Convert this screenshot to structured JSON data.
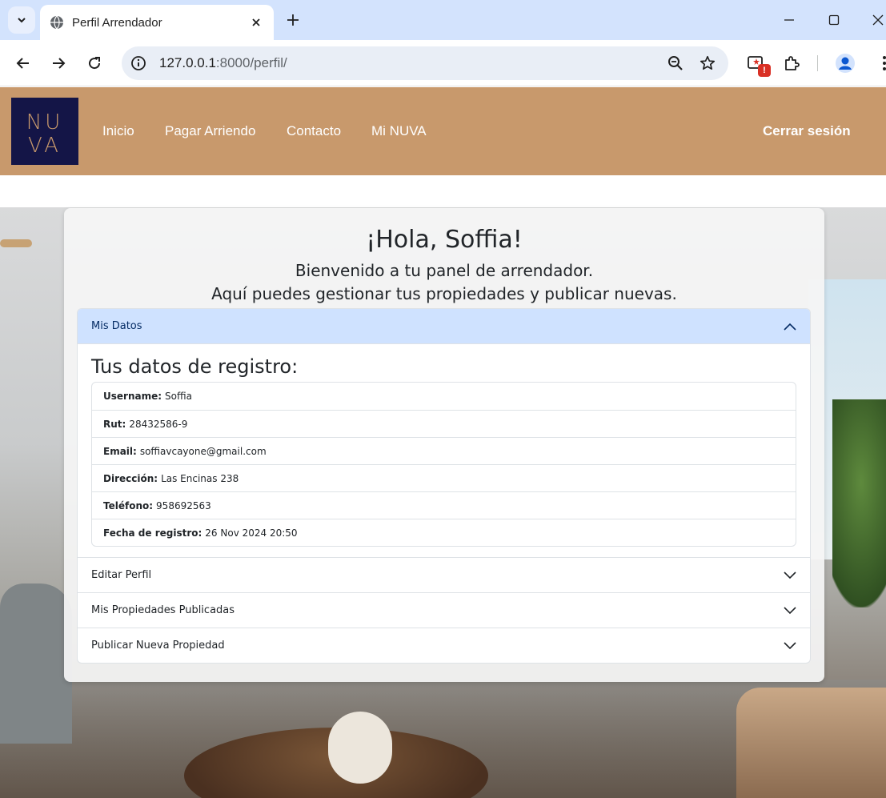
{
  "browser": {
    "tab_title": "Perfil Arrendador",
    "url_host": "127.0.0.1",
    "url_path": ":8000/perfil/",
    "extension_badge": "!"
  },
  "header": {
    "logo_top": "NU",
    "logo_bottom": "VA",
    "nav": [
      "Inicio",
      "Pagar Arriendo",
      "Contacto",
      "Mi NUVA"
    ],
    "logout": "Cerrar sesión"
  },
  "panel": {
    "greeting": "¡Hola, Soffia!",
    "welcome_line1": "Bienvenido a tu panel de arrendador.",
    "welcome_line2": "Aquí puedes gestionar tus propiedades y publicar nuevas."
  },
  "accordion": {
    "mis_datos": "Mis Datos",
    "section_title": "Tus datos de registro:",
    "fields": [
      {
        "label": "Username:",
        "value": "Soffia"
      },
      {
        "label": "Rut:",
        "value": "28432586-9"
      },
      {
        "label": "Email:",
        "value": "soffiavcayone@gmail.com"
      },
      {
        "label": "Dirección:",
        "value": "Las Encinas 238"
      },
      {
        "label": "Teléfono:",
        "value": "958692563"
      },
      {
        "label": "Fecha de registro:",
        "value": "26 Nov 2024 20:50"
      }
    ],
    "editar_perfil": "Editar Perfil",
    "mis_propiedades": "Mis Propiedades Publicadas",
    "publicar_nueva": "Publicar Nueva Propiedad"
  },
  "colors": {
    "header_bg": "#c8996c",
    "logo_bg": "#141547",
    "logo_fg": "#c8996c",
    "active_accordion_bg": "#cfe2ff"
  }
}
